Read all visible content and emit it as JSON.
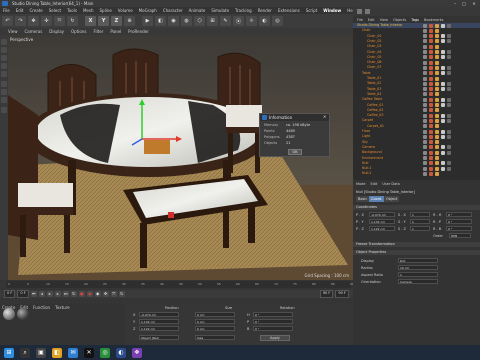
{
  "window": {
    "title": "Studio Dining Table_Interior(64_1) - Main",
    "controls": [
      "–",
      "□",
      "✕"
    ]
  },
  "menubar": {
    "items": [
      "File",
      "Edit",
      "Create",
      "Select",
      "Tools",
      "Mesh",
      "Spline",
      "Volume",
      "MoGraph",
      "Character",
      "Animate",
      "Simulate",
      "Tracking",
      "Render",
      "Extensions",
      "Script",
      "Window",
      "Help"
    ]
  },
  "toolbar": {
    "buttons": [
      "↶",
      "↷",
      "✥",
      "✣",
      "⤧",
      "↻",
      "X",
      "Y",
      "Z",
      "⊕",
      "▶",
      "◧",
      "◉",
      "◍",
      "⬡",
      "⊞",
      "✎",
      "⦿",
      "☼",
      "◐",
      "◎"
    ]
  },
  "viewport_menu": {
    "items": [
      "View",
      "Cameras",
      "Display",
      "Options",
      "Filter",
      "Panel",
      "ProRender"
    ]
  },
  "viewport": {
    "grid_spacing": "Grid Spacing : 100 cm"
  },
  "info_dialog": {
    "title": "Information",
    "rows": [
      {
        "label": "Memory",
        "value": "ca. 198 kByte"
      },
      {
        "label": "Points",
        "value": "4489"
      },
      {
        "label": "Polygons",
        "value": "4387"
      },
      {
        "label": "Objects",
        "value": "21"
      }
    ],
    "ok_label": "OK"
  },
  "timeline": {
    "ticks": [
      "0",
      "5",
      "10",
      "15",
      "20",
      "25",
      "30",
      "35",
      "40",
      "45",
      "50",
      "55",
      "60",
      "65",
      "70",
      "75",
      "80",
      "85",
      "90"
    ],
    "start": "0 F",
    "current": "0 F",
    "end": "90 F",
    "end2": "90 F",
    "frame_display": "0 F"
  },
  "material_panel": {
    "menu": [
      "Create",
      "Edit",
      "Function",
      "Texture"
    ]
  },
  "coordinates": {
    "headers": [
      "Position",
      "Size",
      "Rotation"
    ],
    "rows": [
      {
        "axis": "X",
        "pos": "-0.074 cm",
        "size": "0 cm",
        "rotlabel": "H",
        "rot": "0 °"
      },
      {
        "axis": "Y",
        "pos": "1.132 cm",
        "size": "0 cm",
        "rotlabel": "P",
        "rot": "0 °"
      },
      {
        "axis": "Z",
        "pos": "1.122 cm",
        "size": "0 cm",
        "rotlabel": "B",
        "rot": "0 °"
      }
    ],
    "mode": "Object (Rel)",
    "size_mode": "Size",
    "apply_label": "Apply"
  },
  "right_panel": {
    "tabs": [
      "File",
      "Edit",
      "View",
      "Objects",
      "Tags",
      "Bookmarks"
    ],
    "objects": [
      {
        "name": "Studio Dining Table_Interior",
        "indent": 0,
        "color": "#f0c040"
      },
      {
        "name": "Chair",
        "indent": 1,
        "color": "#e88e2e"
      },
      {
        "name": "Chair_01",
        "indent": 2,
        "color": "#e88e2e"
      },
      {
        "name": "Chair_02",
        "indent": 2,
        "color": "#e88e2e"
      },
      {
        "name": "Chair_03",
        "indent": 2,
        "color": "#e88e2e"
      },
      {
        "name": "Chair_04",
        "indent": 2,
        "color": "#e88e2e"
      },
      {
        "name": "Chair_05",
        "indent": 2,
        "color": "#e88e2e"
      },
      {
        "name": "Chair_06",
        "indent": 2,
        "color": "#e88e2e"
      },
      {
        "name": "Chair_07",
        "indent": 2,
        "color": "#e88e2e"
      },
      {
        "name": "Table",
        "indent": 1,
        "color": "#e88e2e"
      },
      {
        "name": "Table_01",
        "indent": 2,
        "color": "#e88e2e"
      },
      {
        "name": "Table_02",
        "indent": 2,
        "color": "#e88e2e"
      },
      {
        "name": "Table_03",
        "indent": 2,
        "color": "#e88e2e"
      },
      {
        "name": "Table_04",
        "indent": 2,
        "color": "#e88e2e"
      },
      {
        "name": "Coffee Table",
        "indent": 1,
        "color": "#e88e2e"
      },
      {
        "name": "Coffee_01",
        "indent": 2,
        "color": "#e88e2e"
      },
      {
        "name": "Coffee_02",
        "indent": 2,
        "color": "#e88e2e"
      },
      {
        "name": "Coffee_03",
        "indent": 2,
        "color": "#e88e2e"
      },
      {
        "name": "Carpet",
        "indent": 1,
        "color": "#e88e2e"
      },
      {
        "name": "Carpet_01",
        "indent": 2,
        "color": "#e88e2e"
      },
      {
        "name": "Floor",
        "indent": 1,
        "color": "#e88e2e"
      },
      {
        "name": "Light",
        "indent": 1,
        "color": "#e88e2e"
      },
      {
        "name": "Sky",
        "indent": 1,
        "color": "#e88e2e"
      },
      {
        "name": "Camera",
        "indent": 1,
        "color": "#e88e2e"
      },
      {
        "name": "Background",
        "indent": 1,
        "color": "#e88e2e"
      },
      {
        "name": "Environment",
        "indent": 1,
        "color": "#e88e2e"
      },
      {
        "name": "Null",
        "indent": 1,
        "color": "#e88e2e"
      },
      {
        "name": "Null.1",
        "indent": 1,
        "color": "#e88e2e"
      },
      {
        "name": "Null.2",
        "indent": 1,
        "color": "#e88e2e"
      }
    ],
    "attr_menu": [
      "Mode",
      "Edit",
      "User Data"
    ],
    "attr_title": "Null [Studio Dining Table_Interior]",
    "attr_tabs": [
      "Basic",
      "Coord.",
      "Object"
    ],
    "sections": [
      "Coordinates",
      "Freeze Transformation",
      "Object Properties"
    ],
    "coord_rows": [
      {
        "l": "P . X",
        "v": "-0.074 cm",
        "l2": "S . X",
        "v2": "1",
        "l3": "R . H",
        "v3": "0 °"
      },
      {
        "l": "P . Y",
        "v": "1.132 cm",
        "l2": "S . Y",
        "v2": "1",
        "l3": "R . P",
        "v3": "0 °"
      },
      {
        "l": "P . Z",
        "v": "1.122 cm",
        "l2": "S . Z",
        "v2": "1",
        "l3": "R . B",
        "v3": "0 °"
      }
    ],
    "order_label": "Order",
    "order_value": "HPB",
    "props": [
      {
        "label": "Display",
        "value": "Dot"
      },
      {
        "label": "Radius",
        "value": "10 cm"
      },
      {
        "label": "Aspect Ratio",
        "value": "1"
      },
      {
        "label": "Orientation",
        "value": "Camera"
      }
    ]
  },
  "taskbar": {
    "icons": [
      "⊞",
      "⌕",
      "▣",
      "◧",
      "✉",
      "✕",
      "◎",
      "◐",
      "❖"
    ]
  },
  "colors": {
    "accent": "#5a7fb0",
    "selected": "#f0c040",
    "object": "#e88e2e"
  }
}
